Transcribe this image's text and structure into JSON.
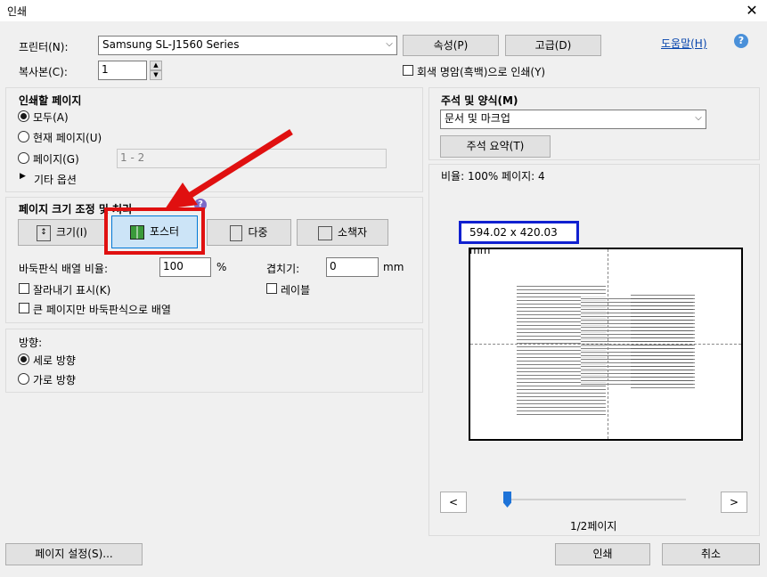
{
  "window": {
    "title": "인쇄",
    "close_icon": "✕"
  },
  "printer": {
    "label": "프린터(N):",
    "value": "Samsung SL-J1560 Series",
    "properties_button": "속성(P)",
    "advanced_button": "고급(D)",
    "help_link": "도움말(H)"
  },
  "copies": {
    "label": "복사본(C):",
    "value": "1"
  },
  "grayscale": {
    "label": "회색 명암(흑백)으로 인쇄(Y)",
    "checked": false
  },
  "pages_to_print": {
    "heading": "인쇄할 페이지",
    "all": "모두(A)",
    "current": "현재 페이지(U)",
    "pages": "페이지(G)",
    "pages_value": "1 - 2",
    "more_options": "기타 옵션",
    "selected": "all"
  },
  "sizing": {
    "heading": "페이지 크기 조정 및 처리",
    "buttons": {
      "size": "크기(I)",
      "poster": "포스터",
      "multiple": "다중",
      "booklet": "소책자"
    },
    "selected": "poster"
  },
  "poster": {
    "tile_scale_label": "바둑판식 배열 비율:",
    "tile_scale_value": "100",
    "percent": "%",
    "overlap_label": "겹치기:",
    "overlap_value": "0",
    "unit": "mm",
    "cut_marks": "잘라내기 표시(K)",
    "labels": "레이블",
    "large_pages_only": "큰 페이지만 바둑판식으로 배열"
  },
  "orientation": {
    "heading": "방향:",
    "portrait": "세로 방향",
    "landscape": "가로 방향",
    "selected": "portrait"
  },
  "comments": {
    "heading": "주석 및 양식(M)",
    "value": "문서 및 마크업",
    "summarize_button": "주석 요약(T)"
  },
  "preview": {
    "scale_text": "비율: 100% 페이지: 4",
    "page_size": "594.02 x 420.03 mm",
    "prev": "<",
    "next": ">",
    "page_indicator": "1/2페이지",
    "slider_position": 0
  },
  "footer": {
    "page_setup": "페이지 설정(S)...",
    "print": "인쇄",
    "cancel": "취소"
  },
  "colors": {
    "highlight_red": "#e01010",
    "highlight_blue": "#1020d0",
    "arrow_red": "#e01010",
    "accent": "#1e73d8"
  }
}
